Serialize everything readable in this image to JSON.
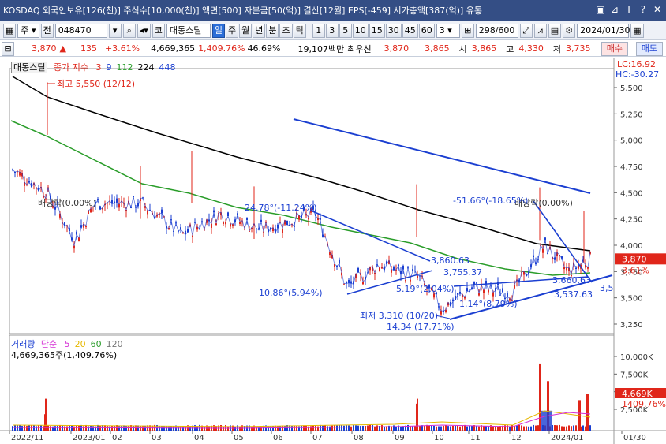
{
  "title_bar": {
    "text": "KOSDAQ 외국인보유[126(천)] 주식수[10,000(천)] 액면[500] 자본금[50(억)] 결산[12월] EPS[-459] 시가총액[387(억)] 유통",
    "icons": [
      "window-restore-icon",
      "pin-icon",
      "text-icon",
      "help-icon",
      "close-icon"
    ]
  },
  "toolbar": {
    "market_label": "주",
    "prev_label": "전",
    "code": "048470",
    "stock_name": "대동스틸",
    "badge_label": "코",
    "period_tabs": [
      "일",
      "주",
      "월",
      "년",
      "분",
      "초",
      "틱"
    ],
    "active_period": "일",
    "interval_buttons": [
      "1",
      "3",
      "5",
      "10",
      "15",
      "30",
      "45",
      "60"
    ],
    "interval_value": "3",
    "count_display": "298/600",
    "date_value": "2024/01/30"
  },
  "info_bar": {
    "price": "3,870",
    "change_arrow": "▲",
    "change": "135",
    "change_pct": "+3.61%",
    "volume": "4,669,365",
    "volume_pct": "1,409.76%",
    "ratio": "46.69%",
    "prev_volume": "19,107백만",
    "priority_label": "최우선",
    "ask": "3,870",
    "bid": "3,865",
    "open_label": "시",
    "open": "3,865",
    "high_label": "고",
    "high": "4,330",
    "low_label": "저",
    "low": "3,735",
    "buy_label": "매수",
    "sell_label": "매도"
  },
  "price_panel": {
    "name_tag": "대동스틸",
    "ma_label": "종가 지수",
    "ma_periods": [
      "3",
      "9",
      "112",
      "224",
      "448"
    ],
    "ma_colors": [
      "#e0261a",
      "#1b3fd1",
      "#2a9d2a",
      "#000000",
      "#1b3fd1"
    ],
    "lc_label": "LC:16.92",
    "hc_label": "HC:-30.27",
    "current_price_tag": "3,870",
    "current_pct_tag": "3.61%",
    "axis_ticks": [
      "5,500",
      "5,250",
      "5,000",
      "4,750",
      "4,500",
      "4,250",
      "4,000",
      "3,750",
      "3,500",
      "3,250"
    ],
    "annotations": {
      "high": "최고 5,550 (12/12)",
      "low": "최저 3,310 (10/20)",
      "low_pct": "14.34 (17.71%)",
      "div1": "배당락(0.00%)",
      "div2": "배당락(0.00%)",
      "trend1": "24.78°(-11.24%)",
      "trend2": "-51.66°(-18.65%)",
      "trend3": "10.86°(5.94%)",
      "trend4": "5.19°(2.04%)",
      "trend5": "1.14°(8.79%)",
      "lvl1": "3,860.63",
      "lvl2": "3,755.37",
      "lvl3": "3,660.63",
      "lvl4": "3,537.63",
      "lvl5": "3,5"
    }
  },
  "volume_panel": {
    "label": "거래량",
    "ma_label": "단순",
    "ma_periods": [
      "5",
      "20",
      "60",
      "120"
    ],
    "ma_colors": [
      "#d42fd4",
      "#e6b800",
      "#2a9d2a",
      "#777777"
    ],
    "value_text": "4,669,365주(1,409.76%)",
    "axis_ticks": [
      "10,000K",
      "7,500K",
      "5,000K",
      "2,500K"
    ],
    "current_tag": "4,669K",
    "current_pct_tag": "1409.76%"
  },
  "x_axis": {
    "labels": [
      "2022/11",
      "2023/01",
      "02",
      "03",
      "04",
      "05",
      "06",
      "07",
      "08",
      "09",
      "10",
      "11",
      "12",
      "2024/01",
      "01/30"
    ]
  }
}
